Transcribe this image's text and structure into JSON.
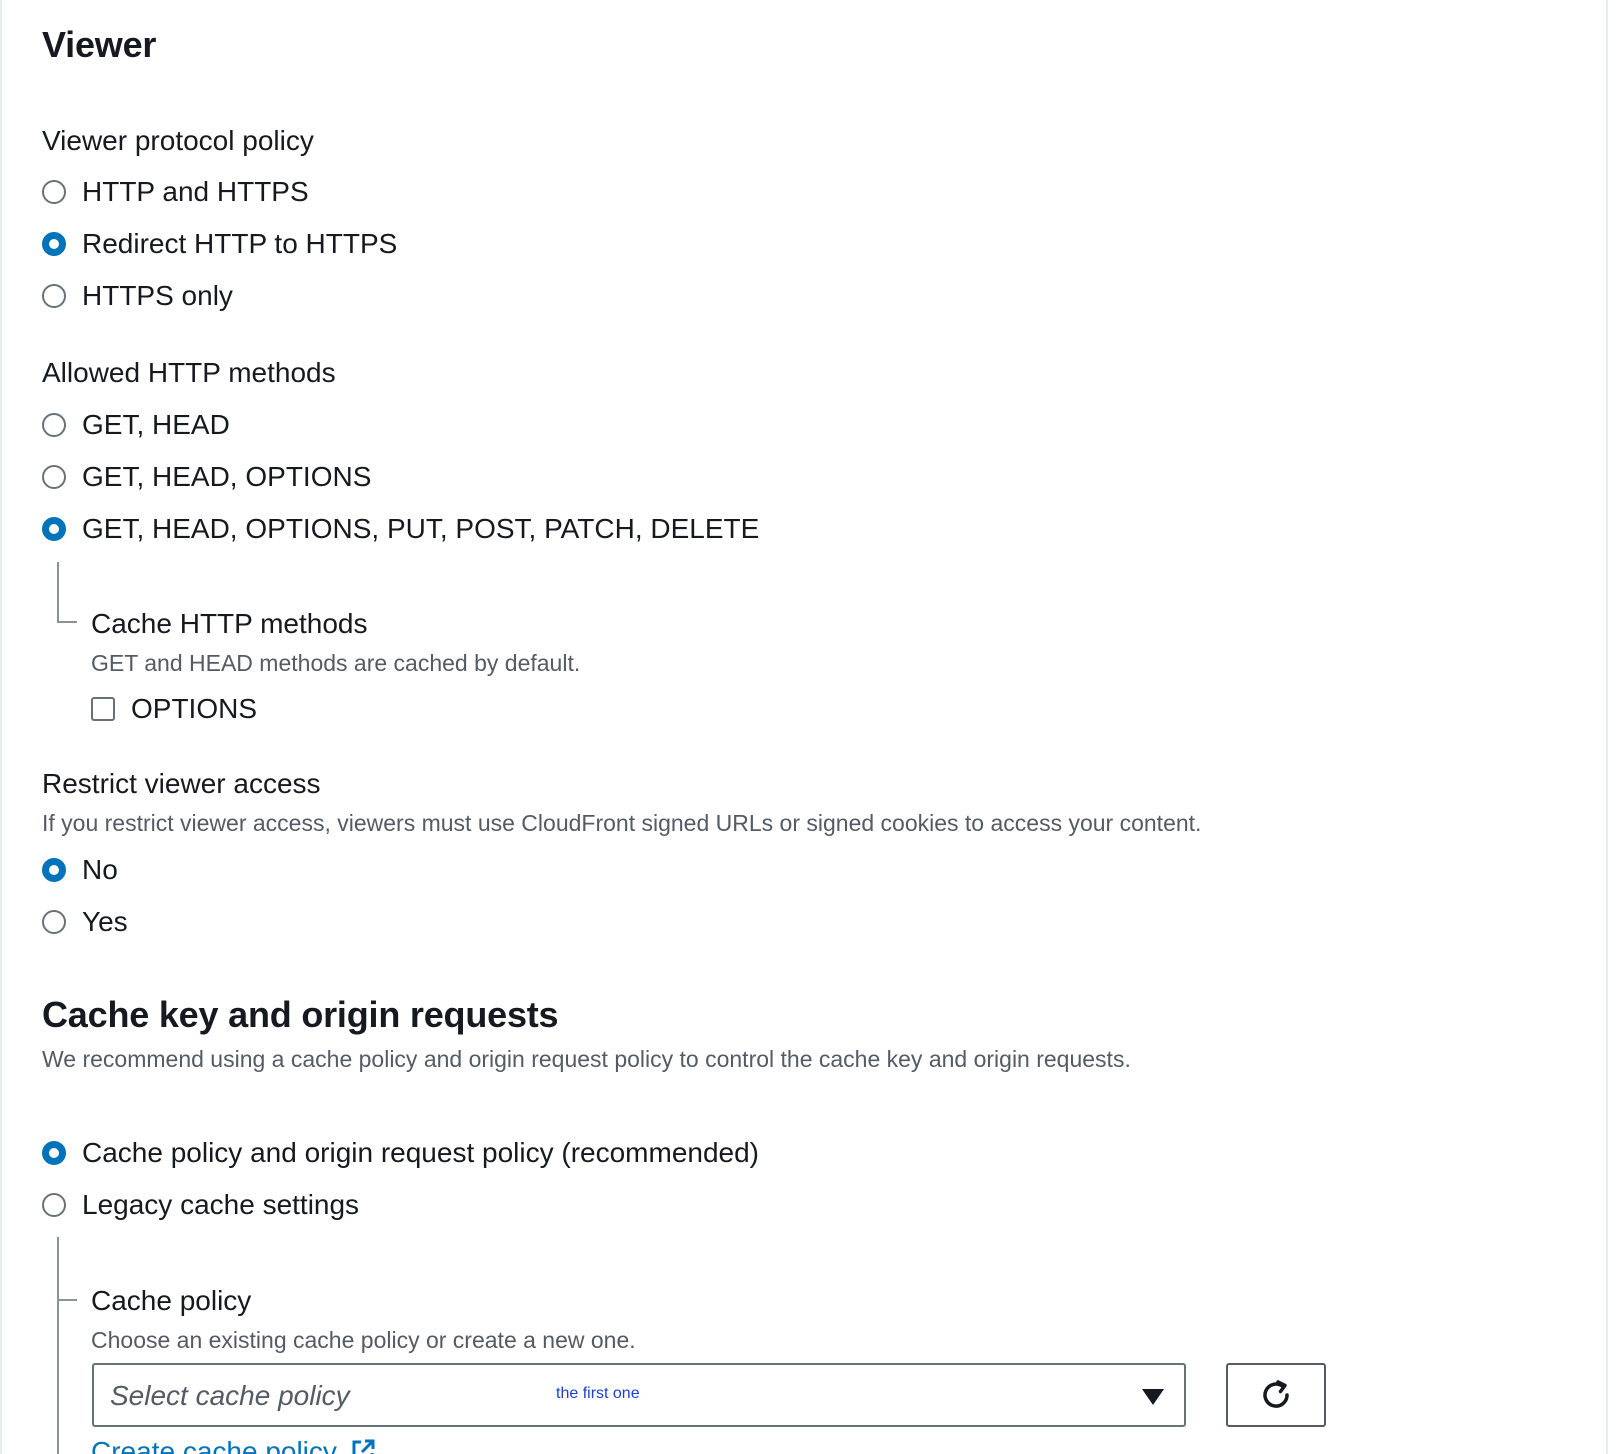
{
  "viewer": {
    "title": "Viewer",
    "protocol_policy": {
      "label": "Viewer protocol policy",
      "options": [
        {
          "label": "HTTP and HTTPS",
          "checked": false
        },
        {
          "label": "Redirect HTTP to HTTPS",
          "checked": true
        },
        {
          "label": "HTTPS only",
          "checked": false
        }
      ]
    },
    "allowed_methods": {
      "label": "Allowed HTTP methods",
      "options": [
        {
          "label": "GET, HEAD",
          "checked": false
        },
        {
          "label": "GET, HEAD, OPTIONS",
          "checked": false
        },
        {
          "label": "GET, HEAD, OPTIONS, PUT, POST, PATCH, DELETE",
          "checked": true
        }
      ],
      "cache_methods": {
        "label": "Cache HTTP methods",
        "description": "GET and HEAD methods are cached by default.",
        "options_checkbox": {
          "label": "OPTIONS",
          "checked": false
        }
      }
    },
    "restrict_access": {
      "label": "Restrict viewer access",
      "description": "If you restrict viewer access, viewers must use CloudFront signed URLs or signed cookies to access your content.",
      "options": [
        {
          "label": "No",
          "checked": true
        },
        {
          "label": "Yes",
          "checked": false
        }
      ]
    }
  },
  "cache_key": {
    "title": "Cache key and origin requests",
    "description": "We recommend using a cache policy and origin request policy to control the cache key and origin requests.",
    "options": [
      {
        "label": "Cache policy and origin request policy (recommended)",
        "checked": true
      },
      {
        "label": "Legacy cache settings",
        "checked": false
      }
    ],
    "cache_policy": {
      "label": "Cache policy",
      "description": "Choose an existing cache policy or create a new one.",
      "select_placeholder": "Select cache policy",
      "select_annotation": "the first one",
      "create_link": "Create cache policy"
    }
  },
  "icons": {
    "refresh": "refresh-icon",
    "caret": "caret-down-icon",
    "external": "external-link-icon"
  },
  "colors": {
    "accent": "#0073bb",
    "text": "#16191f",
    "secondary_text": "#545b64",
    "annotation": "#1a3fd6"
  }
}
